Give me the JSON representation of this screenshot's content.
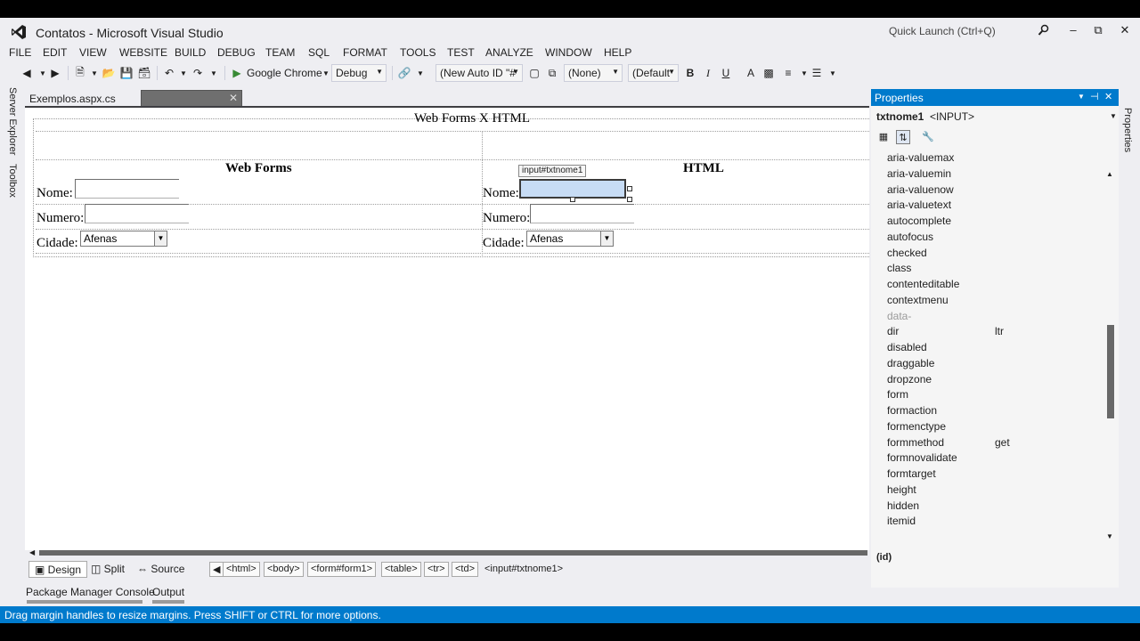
{
  "window": {
    "title": "Contatos - Microsoft Visual Studio",
    "quick_launch": "Quick Launch (Ctrl+Q)"
  },
  "menu": [
    "FILE",
    "EDIT",
    "VIEW",
    "WEBSITE",
    "BUILD",
    "DEBUG",
    "TEAM",
    "SQL",
    "FORMAT",
    "TOOLS",
    "TEST",
    "ANALYZE",
    "WINDOW",
    "HELP"
  ],
  "toolbar": {
    "run_target": "Google Chrome",
    "configuration": "Debug",
    "auto_id": "(New Auto ID \"#",
    "class_combo": "(None)",
    "font_combo": "(Default",
    "bold": "B",
    "italic": "I",
    "underline": "U"
  },
  "side_tabs": {
    "server_explorer": "Server Explorer",
    "toolbox": "Toolbox",
    "properties": "Properties"
  },
  "doc_tabs": {
    "active": "Exemplos.aspx.cs"
  },
  "design": {
    "title": "Web Forms X HTML",
    "col1_header": "Web Forms",
    "col2_header": "HTML",
    "label_nome": "Nome:",
    "label_numero": "Numero:",
    "label_cidade": "Cidade:",
    "select_value": "Afenas",
    "selected_tag": "input#txtnome1"
  },
  "view_bar": {
    "design": "Design",
    "split": "Split",
    "source": "Source",
    "crumbs": [
      "<html>",
      "<body>",
      "<form#form1>",
      "<table>",
      "<tr>",
      "<td>"
    ],
    "current": "<input#txtnome1>"
  },
  "bottom_tabs": {
    "package_manager": "Package Manager Console",
    "output": "Output"
  },
  "status": "Drag margin handles to resize margins. Press SHIFT or CTRL for more options.",
  "properties": {
    "title": "Properties",
    "object_name": "txtnome1",
    "object_type": "<INPUT>",
    "rows": [
      {
        "name": "aria-valuemax",
        "value": ""
      },
      {
        "name": "aria-valuemin",
        "value": ""
      },
      {
        "name": "aria-valuenow",
        "value": ""
      },
      {
        "name": "aria-valuetext",
        "value": ""
      },
      {
        "name": "autocomplete",
        "value": ""
      },
      {
        "name": "autofocus",
        "value": ""
      },
      {
        "name": "checked",
        "value": ""
      },
      {
        "name": "class",
        "value": ""
      },
      {
        "name": "contenteditable",
        "value": ""
      },
      {
        "name": "contextmenu",
        "value": ""
      },
      {
        "name": "data-",
        "value": ""
      },
      {
        "name": "dir",
        "value": "ltr"
      },
      {
        "name": "disabled",
        "value": ""
      },
      {
        "name": "draggable",
        "value": ""
      },
      {
        "name": "dropzone",
        "value": ""
      },
      {
        "name": "form",
        "value": ""
      },
      {
        "name": "formaction",
        "value": ""
      },
      {
        "name": "formenctype",
        "value": ""
      },
      {
        "name": "formmethod",
        "value": "get"
      },
      {
        "name": "formnovalidate",
        "value": ""
      },
      {
        "name": "formtarget",
        "value": ""
      },
      {
        "name": "height",
        "value": ""
      },
      {
        "name": "hidden",
        "value": ""
      },
      {
        "name": "itemid",
        "value": ""
      }
    ],
    "description": "(id)"
  },
  "colors": {
    "accent": "#007acc",
    "chrome": "#eeeef2",
    "selection": "#c7dcf5"
  }
}
